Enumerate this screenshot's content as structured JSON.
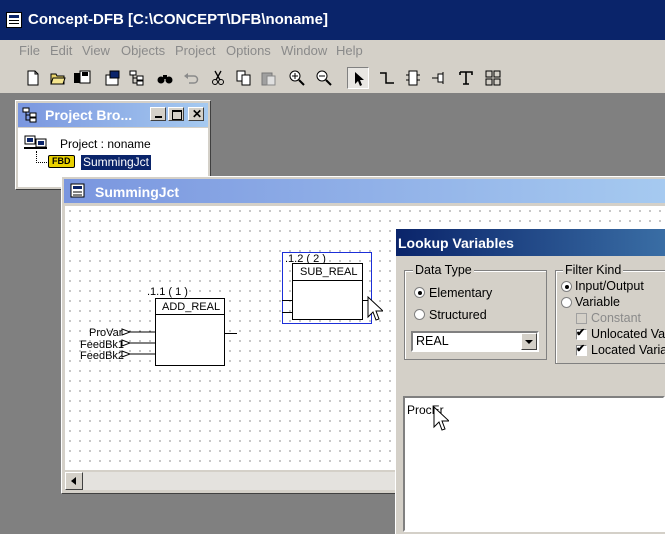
{
  "app": {
    "title": "Concept-DFB [C:\\CONCEPT\\DFB\\noname]",
    "icon": "app-window-icon"
  },
  "menu": [
    "File",
    "Edit",
    "View",
    "Objects",
    "Project",
    "Options",
    "Window",
    "Help"
  ],
  "toolbar": {
    "icons": [
      "new-file-icon",
      "open-folder-icon",
      "save-icon",
      "properties-icon",
      "structure-tree-icon",
      "find-icon",
      "undo-icon",
      "cut-icon",
      "copy-icon",
      "paste-icon",
      "zoom-in-icon",
      "zoom-out-icon",
      "select-pointer-icon",
      "link-icon",
      "ffb-icon",
      "variable-icon",
      "text-icon",
      "grid-icon"
    ]
  },
  "project_browser": {
    "title": "Project Bro...",
    "root_label": "Project : noname",
    "fbd_tag": "FBD",
    "item_label": "SummingJct"
  },
  "editor": {
    "title": "SummingJct",
    "blocks": [
      {
        "id_label": ".1.1 ( 1 )",
        "name": "ADD_REAL"
      },
      {
        "id_label": ".1.2 ( 2 )",
        "name": "SUB_REAL"
      }
    ],
    "inputs": [
      "ProVar",
      "FeedBk1",
      "FeedBk2"
    ]
  },
  "lookup": {
    "title": "Lookup Variables",
    "data_type": {
      "label": "Data Type",
      "options": [
        "Elementary",
        "Structured"
      ],
      "selected": "Elementary",
      "combo_value": "REAL"
    },
    "filter_kind": {
      "label": "Filter Kind",
      "radios": [
        "Input/Output",
        "Variable"
      ],
      "selected": "Input/Output",
      "checks": [
        {
          "label": "Constant",
          "checked": false,
          "disabled": true
        },
        {
          "label": "Unlocated Vari",
          "checked": true,
          "disabled": false
        },
        {
          "label": "Located Varia",
          "checked": true,
          "disabled": false
        }
      ]
    },
    "list_first_item": "ProcEr"
  }
}
